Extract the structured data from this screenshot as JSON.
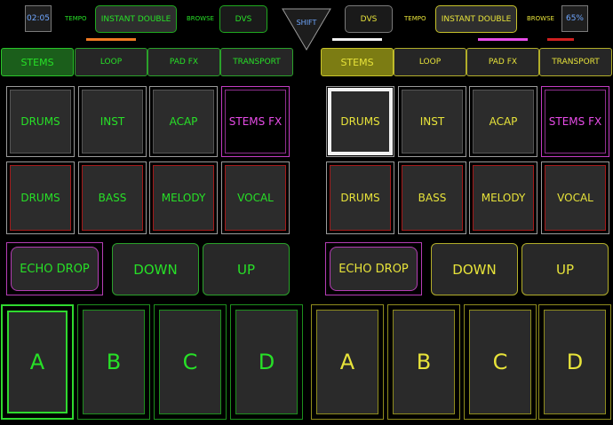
{
  "colors": {
    "green": "#27e027",
    "yellow": "#e7e33a",
    "magenta": "#e84ce8",
    "orange": "#f07a22",
    "white": "#f2f2f2",
    "red": "#d02020",
    "blue": "#6fa7ff"
  },
  "topbar": {
    "left": {
      "time": "02:05",
      "tempo_label": "TEMPO",
      "tempo_value": "INSTANT DOUBLE",
      "browse_label": "BROWSE",
      "browse_value": "DVS"
    },
    "shift_label": "SHIFT",
    "right": {
      "browse_value": "DVS",
      "tempo_label": "TEMPO",
      "tempo_value": "INSTANT DOUBLE",
      "browse_label": "BROWSE",
      "percent": "65%"
    }
  },
  "decks": {
    "left": {
      "tabs": [
        "STEMS",
        "LOOP",
        "PAD FX",
        "TRANSPORT"
      ],
      "row1": [
        "DRUMS",
        "INST",
        "ACAP",
        "STEMS FX"
      ],
      "row2": [
        "DRUMS",
        "BASS",
        "MELODY",
        "VOCAL"
      ],
      "echo": "ECHO DROP",
      "down": "DOWN",
      "up": "UP",
      "hotcues": [
        "A",
        "B",
        "C",
        "D"
      ]
    },
    "right": {
      "tabs": [
        "STEMS",
        "LOOP",
        "PAD FX",
        "TRANSPORT"
      ],
      "row1": [
        "DRUMS",
        "INST",
        "ACAP",
        "STEMS FX"
      ],
      "row2": [
        "DRUMS",
        "BASS",
        "MELODY",
        "VOCAL"
      ],
      "echo": "ECHO DROP",
      "down": "DOWN",
      "up": "UP",
      "hotcues": [
        "A",
        "B",
        "C",
        "D"
      ]
    }
  }
}
